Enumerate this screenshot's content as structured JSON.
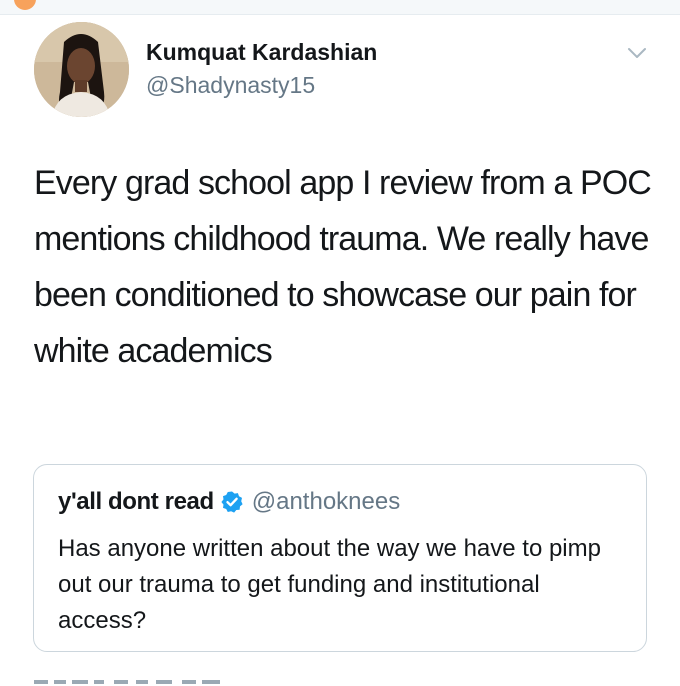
{
  "author": {
    "display_name": "Kumquat Kardashian",
    "handle": "@Shadynasty15",
    "avatar_icon": "profile-photo"
  },
  "tweet": {
    "text": "Every grad school app I review from a POC mentions childhood trauma. We really have been conditioned to showcase our pain for white academics"
  },
  "quoted_tweet": {
    "display_name": "y'all dont read",
    "verified": true,
    "handle": "@anthoknees",
    "text": "Has anyone written about the way we have to pimp out our trauma to get funding and institutional access?"
  },
  "menu": {
    "icon": "chevron-down-icon"
  },
  "colors": {
    "text": "#14171a",
    "secondary": "#657786",
    "verified_blue": "#1da1f2",
    "border": "#ccd6dd"
  }
}
